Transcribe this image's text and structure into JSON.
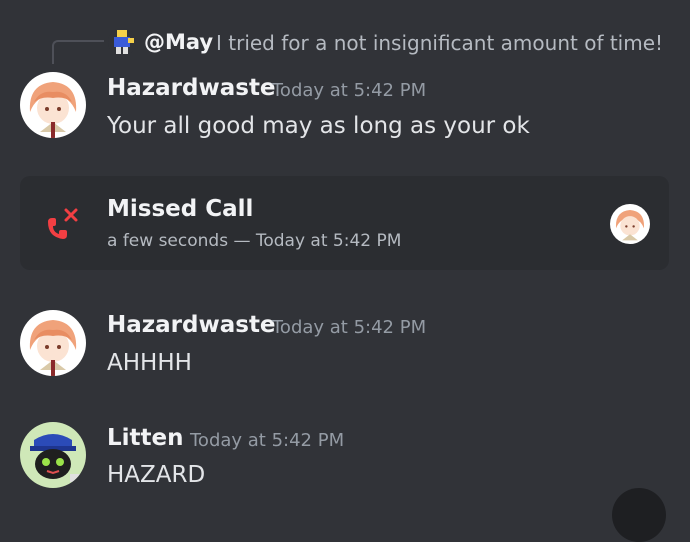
{
  "reply": {
    "author": "@May",
    "text": "I tried for a not insignificant amount of time!"
  },
  "messages": [
    {
      "author": "Hazardwaste",
      "timestamp": "Today at 5:42 PM",
      "text": "Your all good may as long as your ok"
    },
    {
      "author": "Hazardwaste",
      "timestamp": "Today at 5:42 PM",
      "text": "AHHHH"
    },
    {
      "author": "Litten",
      "timestamp": "Today at 5:42 PM",
      "text": "HAZARD"
    }
  ],
  "call": {
    "title": "Missed Call",
    "subtitle": "a few seconds — Today at 5:42 PM",
    "icon": "missed-call-icon",
    "icon_color": "#f23f43"
  },
  "colors": {
    "background": "#313338",
    "card": "#2b2d31",
    "timestamp": "#949ba4"
  }
}
